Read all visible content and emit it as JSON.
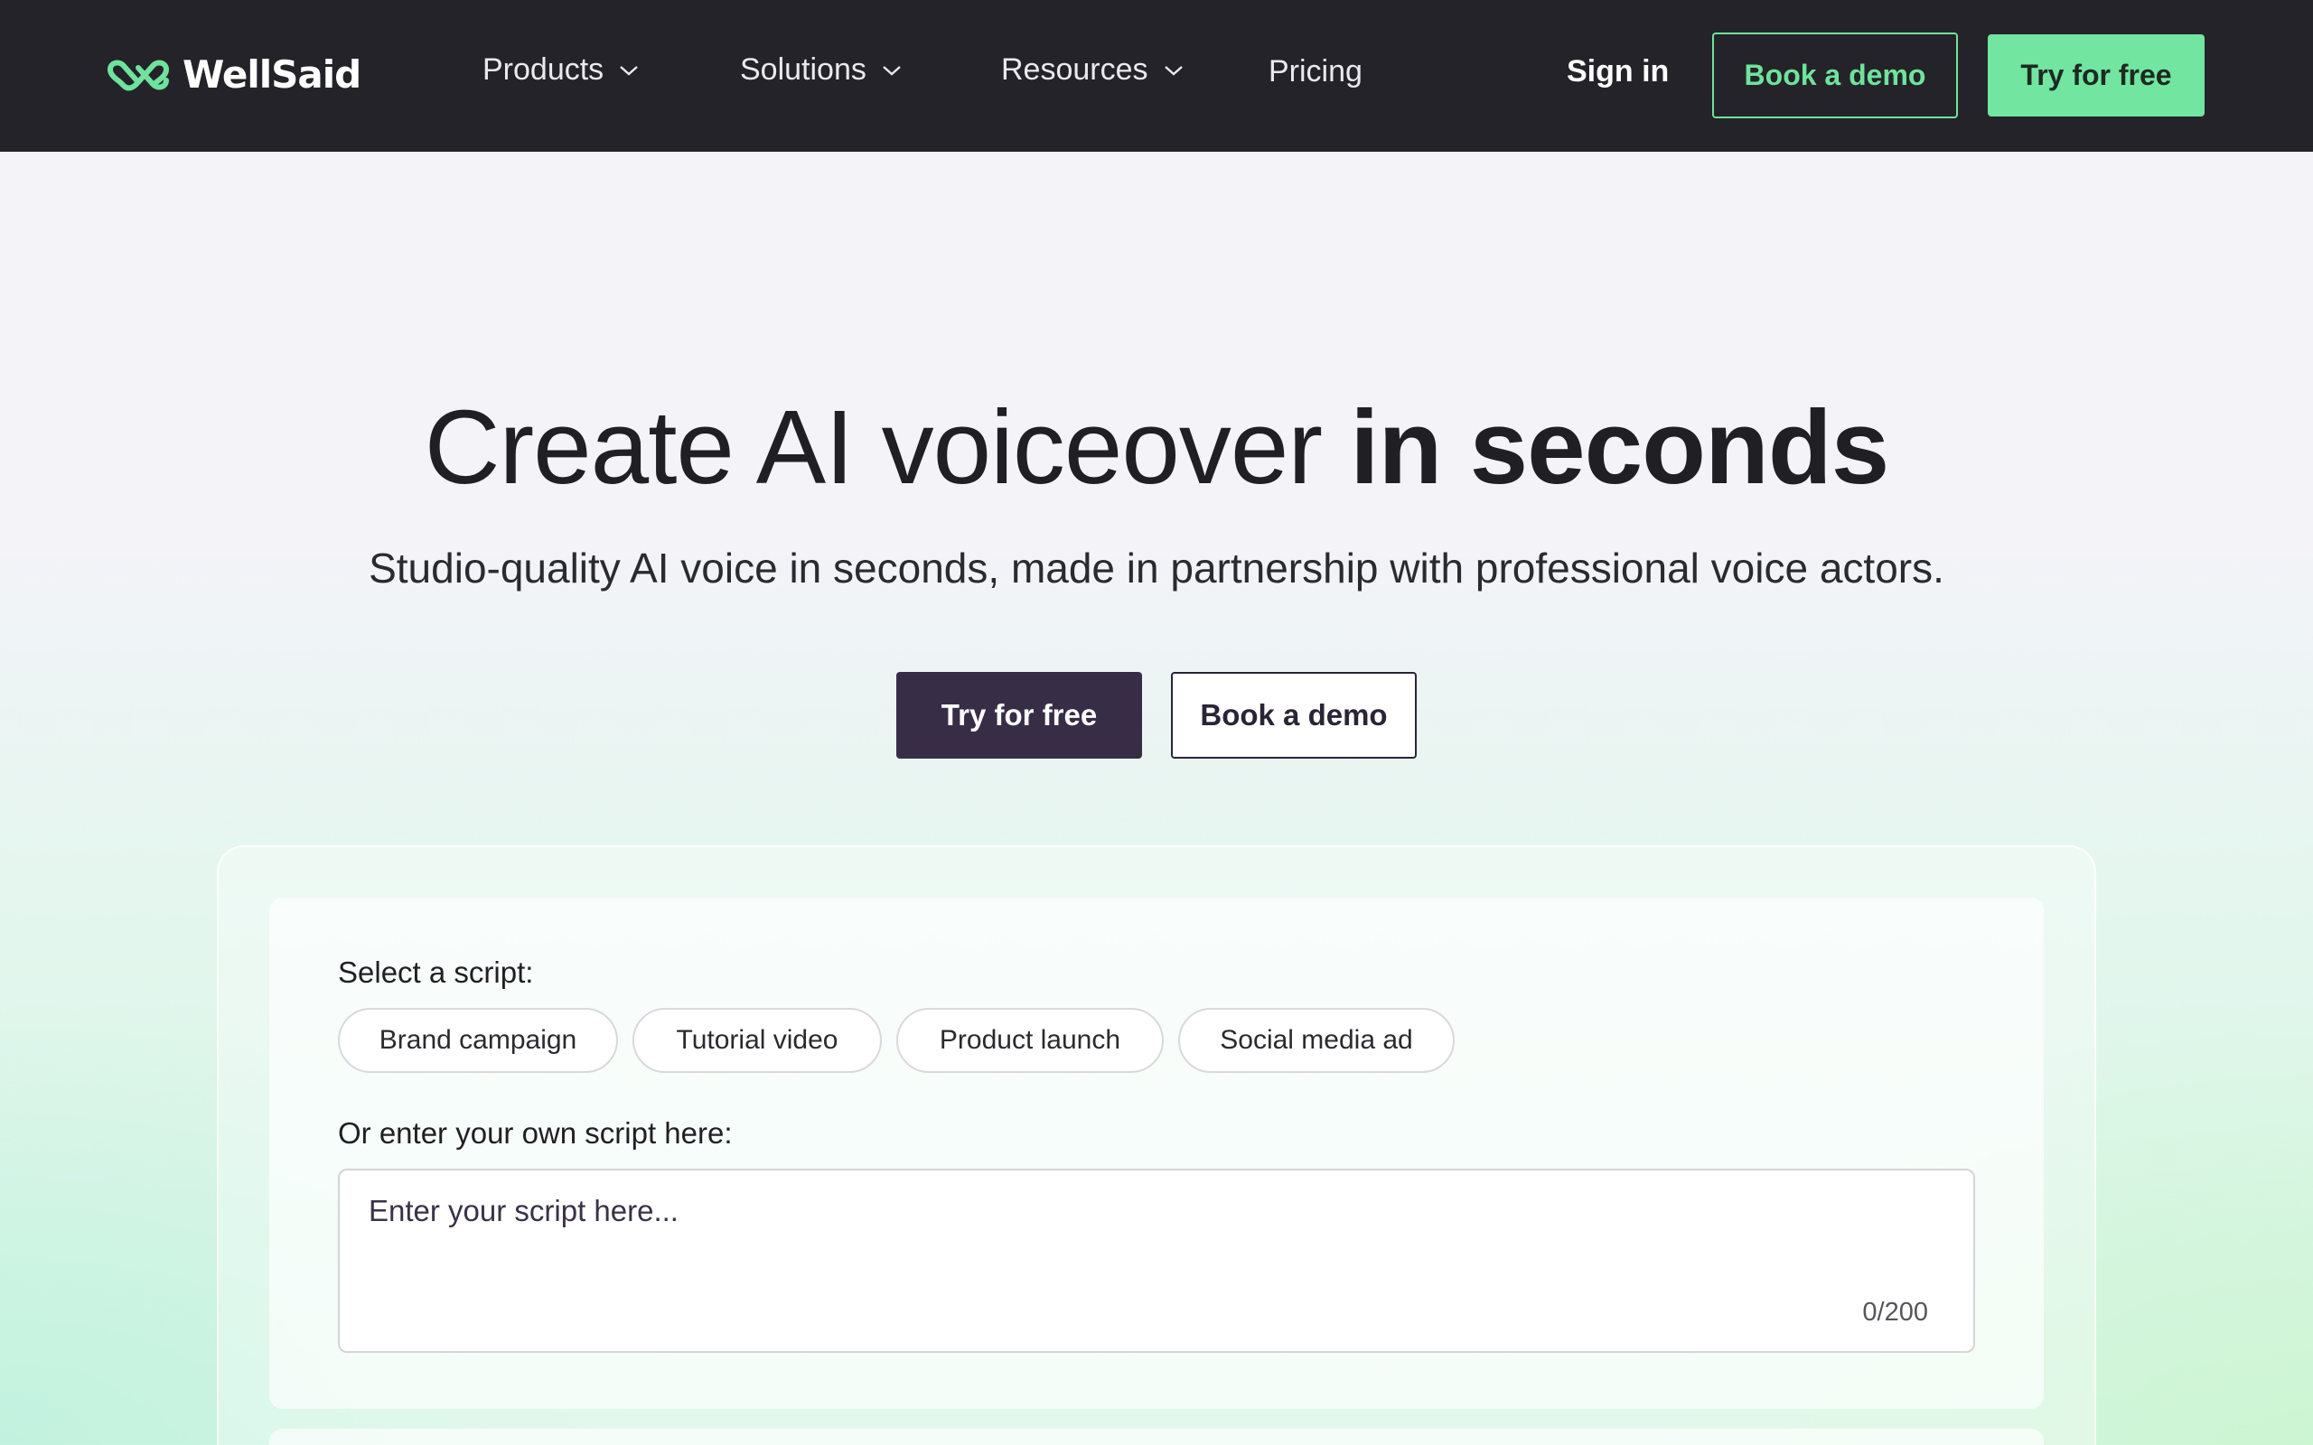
{
  "brand": {
    "name": "WellSaid",
    "accent": "#6fe39b",
    "dark": "#232329",
    "primary": "#372d47"
  },
  "nav": {
    "items": [
      {
        "label": "Products",
        "has_dropdown": true
      },
      {
        "label": "Solutions",
        "has_dropdown": true
      },
      {
        "label": "Resources",
        "has_dropdown": true
      },
      {
        "label": "Pricing",
        "has_dropdown": false
      }
    ],
    "sign_in": "Sign in",
    "book_demo": "Book a demo",
    "try_free": "Try for free"
  },
  "hero": {
    "title_regular": "Create AI voiceover ",
    "title_bold": "in seconds",
    "subtitle": "Studio-quality AI voice in seconds, made in partnership with professional voice actors.",
    "try_free": "Try for free",
    "book_demo": "Book a demo"
  },
  "demo": {
    "select_label": "Select a script:",
    "chips": [
      "Brand campaign",
      "Tutorial video",
      "Product launch",
      "Social media ad"
    ],
    "own_label": "Or enter your own script here:",
    "script_placeholder": "Enter your script here...",
    "script_value": "",
    "char_count": "0/200"
  }
}
